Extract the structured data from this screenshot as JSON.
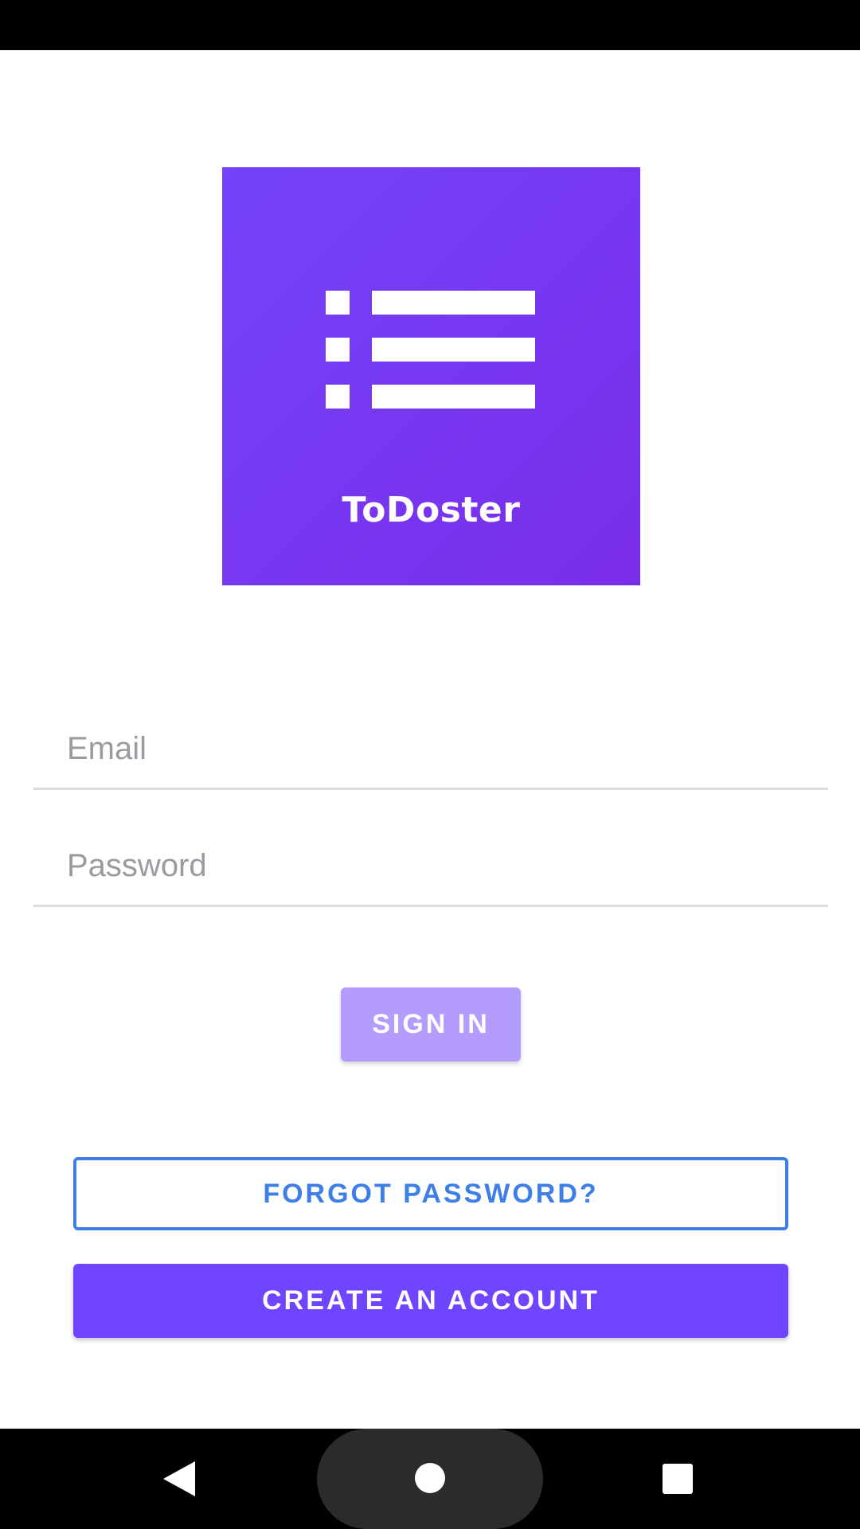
{
  "app": {
    "logo_name": "ToDoster"
  },
  "form": {
    "email": {
      "value": "",
      "placeholder": "Email"
    },
    "password": {
      "value": "",
      "placeholder": "Password"
    }
  },
  "buttons": {
    "sign_in_label": "SIGN IN",
    "forgot_password_label": "FORGOT PASSWORD?",
    "create_account_label": "CREATE AN ACCOUNT"
  },
  "colors": {
    "logo_gradient_start": "#7443fb",
    "logo_gradient_end": "#7a2de8",
    "sign_in_disabled": "#b49cff",
    "outline_blue": "#3d7fe6",
    "primary_purple": "#6f45ff"
  },
  "icons": {
    "logo_icon": "list-icon",
    "nav_back": "back-triangle-icon",
    "nav_home": "home-circle-icon",
    "nav_recents": "recents-square-icon"
  }
}
